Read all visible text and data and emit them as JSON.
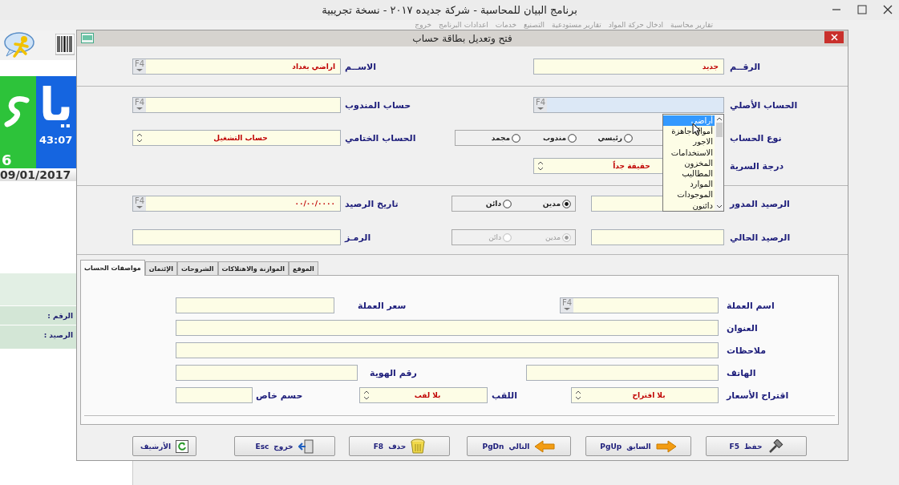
{
  "app": {
    "title": "برنامج البيان للمحاسبة  -  شركة جديده ٢٠١٧ - نسخة تجريبية",
    "menu": [
      "تقارير محاسبة",
      "ادخال حركة المواد",
      "تقارير مستودعية",
      "التصنيع",
      "خدمات",
      "اعدادات البرنامج",
      "خروج"
    ]
  },
  "side_panel": {
    "logo_text": "يا",
    "digit": "6",
    "clock": "43:07",
    "date": "09/01/2017",
    "info_labels": [
      "الرقم :",
      "الرصيد :"
    ]
  },
  "dialog": {
    "title": "فتح وتعديل بطاقة حساب",
    "sections": [
      {
        "rows": [
          {
            "items": [
              {
                "kind": "field",
                "label": "الرقــم",
                "value": "جديد",
                "focused": false
              },
              {
                "kind": "field",
                "label": "الاســم",
                "value": "اراضي بغداد",
                "button": "F4",
                "focused": false
              }
            ]
          }
        ]
      },
      {
        "rows": [
          {
            "items": [
              {
                "kind": "field",
                "label": "الحساب الأصلي",
                "button": "F4",
                "focused": true
              },
              {
                "kind": "field",
                "label": "حساب المندوب",
                "button": "F4",
                "focused": false
              }
            ]
          },
          {
            "items": [
              {
                "kind": "radios",
                "label": "نوع الحساب",
                "disabled": false,
                "options": [
                  {
                    "label": "رئيسي",
                    "selected": false
                  },
                  {
                    "label": "مندوب",
                    "selected": false
                  },
                  {
                    "label": "مجمد",
                    "selected": false
                  }
                ]
              },
              {
                "kind": "spin",
                "label": "الحساب الختامي",
                "value": "حساب التشغيل"
              }
            ]
          },
          {
            "items": [
              {
                "kind": "spin",
                "label": "درجة السرية",
                "value": "حقيقة جداً"
              }
            ]
          }
        ]
      },
      {
        "rows": [
          {
            "items": [
              {
                "kind": "radios_field",
                "label": "الرصيد المدور",
                "disabled": false,
                "options": [
                  {
                    "label": "مدين",
                    "selected": true
                  },
                  {
                    "label": "دائن",
                    "selected": false
                  }
                ]
              },
              {
                "kind": "field",
                "label": "تاريخ الرصيد",
                "value": "٠٠/٠٠/٠٠٠٠",
                "button": "F4",
                "focused": false
              }
            ]
          },
          {
            "items": [
              {
                "kind": "radios_field",
                "label": "الرصيد الحالي",
                "disabled": true,
                "options": [
                  {
                    "label": "مدين",
                    "selected": true
                  },
                  {
                    "label": "دائن",
                    "selected": false
                  }
                ]
              },
              {
                "kind": "field",
                "label": "الرمـز",
                "focused": false
              }
            ]
          }
        ]
      }
    ],
    "dropdown": {
      "items": [
        {
          "label": "أراضي",
          "selected": true
        },
        {
          "label": "أموال جاهزة",
          "selected": false
        },
        {
          "label": "الاجور",
          "selected": false
        },
        {
          "label": "الاستخدامات",
          "selected": false
        },
        {
          "label": "المخزون",
          "selected": false
        },
        {
          "label": "المطاليب",
          "selected": false
        },
        {
          "label": "الموارد",
          "selected": false
        },
        {
          "label": "الموجودات",
          "selected": false
        },
        {
          "label": "دائنون",
          "selected": false
        }
      ]
    },
    "tabs": [
      {
        "label": "الموقع",
        "selected": false
      },
      {
        "label": "الموازنة والاهتلاكات",
        "selected": false
      },
      {
        "label": "الشروحات",
        "selected": false
      },
      {
        "label": "الإئتمان",
        "selected": false
      },
      {
        "label": "مواصفات الحساب",
        "selected": true
      }
    ],
    "tab_rows": [
      {
        "items": [
          {
            "kind": "field",
            "label": "اسم العملة",
            "button": "F4"
          },
          {
            "kind": "field",
            "label": "سعر العملة"
          }
        ]
      },
      {
        "items": [
          {
            "kind": "field",
            "label": "العنوان"
          }
        ]
      },
      {
        "items": [
          {
            "kind": "field",
            "label": "ملاحظات"
          }
        ]
      },
      {
        "items": [
          {
            "kind": "field",
            "label": "الهاتف"
          },
          {
            "kind": "field",
            "label": "رقم الهوية"
          }
        ]
      },
      {
        "items": [
          {
            "kind": "spin",
            "label": "اقتراح الأسعار",
            "value": "بلا اقتراح"
          },
          {
            "kind": "spin",
            "label": "اللقب",
            "value": "بلا لقب"
          },
          {
            "kind": "field",
            "label": "حسم خاص"
          }
        ]
      }
    ],
    "buttons": [
      {
        "kind": "save",
        "label": "حفظ",
        "key": "F5"
      },
      {
        "kind": "previous",
        "label": "السابق",
        "key": "PgUp"
      },
      {
        "kind": "next",
        "label": "التالي",
        "key": "PgDn"
      },
      {
        "kind": "delete",
        "label": "حذف",
        "key": "F8"
      },
      {
        "kind": "exit",
        "label": "خروج",
        "key": "Esc"
      },
      {
        "kind": "archive",
        "label": "الأرشيف"
      }
    ]
  }
}
